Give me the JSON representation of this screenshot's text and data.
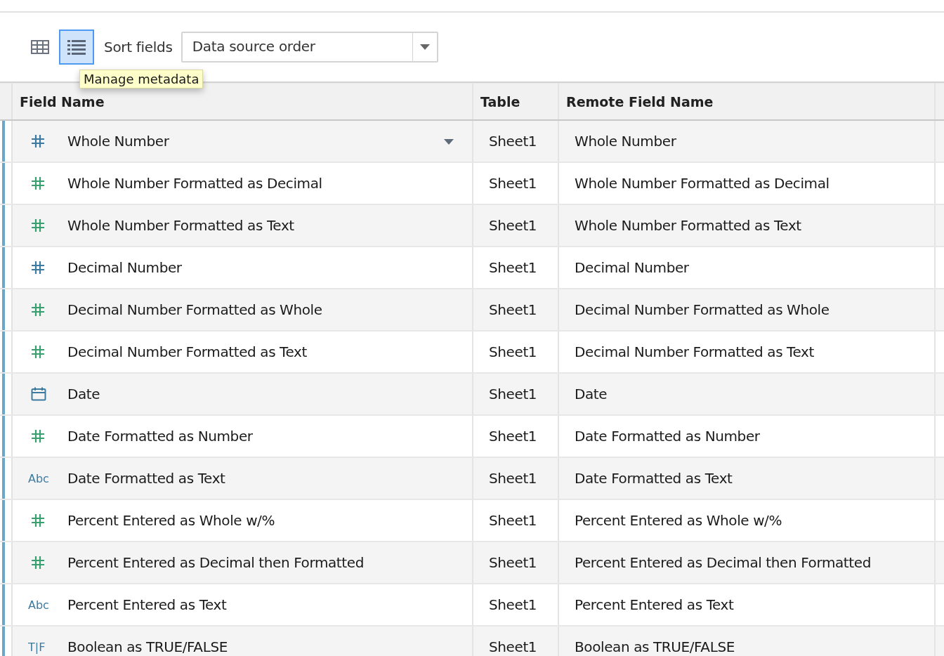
{
  "toolbar": {
    "views": [
      {
        "kind": "grid",
        "selected": false
      },
      {
        "kind": "list",
        "selected": true
      }
    ],
    "sort_label": "Sort fields",
    "sort_value": "Data source order"
  },
  "tooltip": "Manage metadata",
  "table": {
    "columns": [
      "Field Name",
      "Table",
      "Remote Field Name"
    ],
    "rows": [
      {
        "kind": "number",
        "color": "#3c7aa0",
        "name": "Whole Number",
        "table": "Sheet1",
        "remote": "Whole Number",
        "hovered": true
      },
      {
        "kind": "number",
        "color": "#3a9f6e",
        "name": "Whole Number Formatted as Decimal",
        "table": "Sheet1",
        "remote": "Whole Number Formatted as Decimal",
        "hovered": false
      },
      {
        "kind": "number",
        "color": "#3a9f6e",
        "name": "Whole Number Formatted as Text",
        "table": "Sheet1",
        "remote": "Whole Number Formatted as Text",
        "hovered": false
      },
      {
        "kind": "number",
        "color": "#3c7aa0",
        "name": "Decimal Number",
        "table": "Sheet1",
        "remote": "Decimal Number",
        "hovered": false
      },
      {
        "kind": "number",
        "color": "#3a9f6e",
        "name": "Decimal Number Formatted as Whole",
        "table": "Sheet1",
        "remote": "Decimal Number Formatted as Whole",
        "hovered": false
      },
      {
        "kind": "number",
        "color": "#3a9f6e",
        "name": "Decimal Number Formatted as Text",
        "table": "Sheet1",
        "remote": "Decimal Number Formatted as Text",
        "hovered": false
      },
      {
        "kind": "date",
        "color": "#3c7aa0",
        "name": "Date",
        "table": "Sheet1",
        "remote": "Date",
        "hovered": false
      },
      {
        "kind": "number",
        "color": "#3a9f6e",
        "name": "Date Formatted as Number",
        "table": "Sheet1",
        "remote": "Date Formatted as Number",
        "hovered": false
      },
      {
        "kind": "string",
        "color": "#3c7aa0",
        "icon_text": "Abc",
        "name": "Date Formatted as Text",
        "table": "Sheet1",
        "remote": "Date Formatted as Text",
        "hovered": false
      },
      {
        "kind": "number",
        "color": "#3a9f6e",
        "name": "Percent Entered as Whole w/%",
        "table": "Sheet1",
        "remote": "Percent Entered as Whole w/%",
        "hovered": false
      },
      {
        "kind": "number",
        "color": "#3a9f6e",
        "name": "Percent Entered as Decimal then Formatted",
        "table": "Sheet1",
        "remote": "Percent Entered as Decimal then Formatted",
        "hovered": false
      },
      {
        "kind": "string",
        "color": "#3c7aa0",
        "icon_text": "Abc",
        "name": "Percent Entered as Text",
        "table": "Sheet1",
        "remote": "Percent Entered as Text",
        "hovered": false
      },
      {
        "kind": "boolean",
        "color": "#3c7aa0",
        "icon_text": "T|F",
        "name": "Boolean as TRUE/FALSE",
        "table": "Sheet1",
        "remote": "Boolean as TRUE/FALSE",
        "hovered": false
      }
    ]
  }
}
